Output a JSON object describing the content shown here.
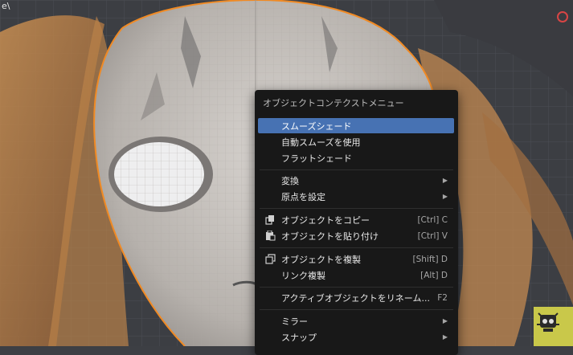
{
  "viewport": {
    "corner_text": "e\\"
  },
  "context_menu": {
    "title": "オブジェクトコンテクストメニュー",
    "items": [
      {
        "label": "スムーズシェード",
        "shortcut": "",
        "active": true
      },
      {
        "label": "自動スムーズを使用",
        "shortcut": ""
      },
      {
        "label": "フラットシェード",
        "shortcut": ""
      },
      {
        "label": "変換",
        "shortcut": "",
        "submenu": true
      },
      {
        "label": "原点を設定",
        "shortcut": "",
        "submenu": true
      },
      {
        "label": "オブジェクトをコピー",
        "shortcut": "[Ctrl] C",
        "icon": "copy-icon"
      },
      {
        "label": "オブジェクトを貼り付け",
        "shortcut": "[Ctrl] V",
        "icon": "paste-icon"
      },
      {
        "label": "オブジェクトを複製",
        "shortcut": "[Shift] D",
        "icon": "duplicate-icon"
      },
      {
        "label": "リンク複製",
        "shortcut": "[Alt] D"
      },
      {
        "label": "アクティブオブジェクトをリネーム...",
        "shortcut": "F2"
      },
      {
        "label": "ミラー",
        "shortcut": "",
        "submenu": true
      },
      {
        "label": "スナップ",
        "shortcut": "",
        "submenu": true
      }
    ]
  },
  "colors": {
    "highlight": "#4772b3",
    "selection_outline": "#f08a24",
    "menu_bg": "#181818"
  }
}
